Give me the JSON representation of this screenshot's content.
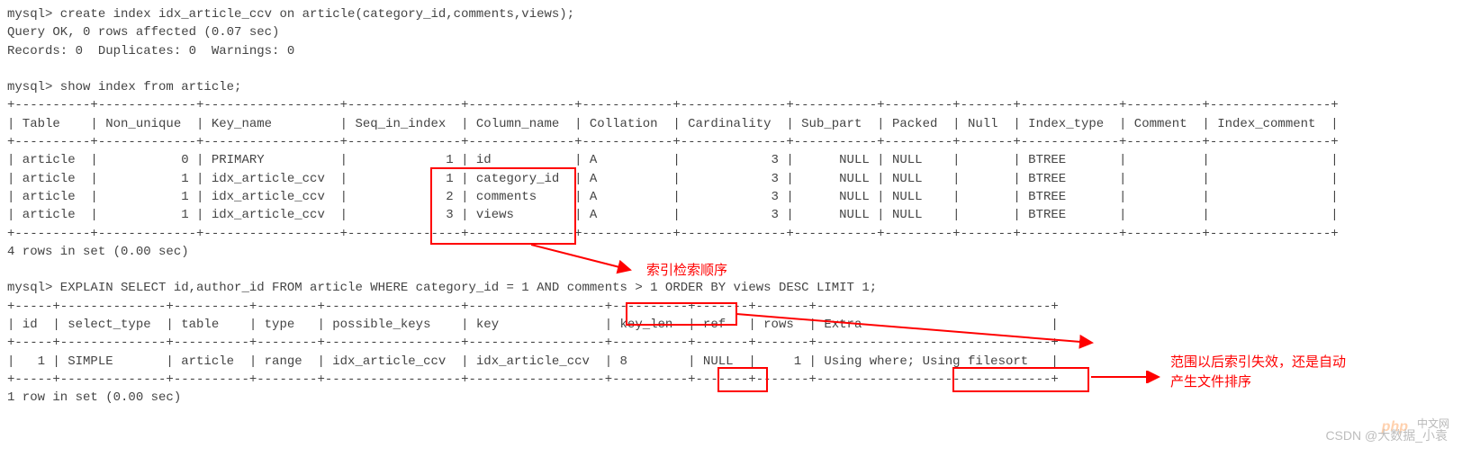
{
  "cmd": {
    "prompt": "mysql>",
    "create_index": "create index idx_article_ccv on article(category_id,comments,views);",
    "query_ok": "Query OK, 0 rows affected (0.07 sec)",
    "records": "Records: 0  Duplicates: 0  Warnings: 0",
    "show_index": "show index from article;",
    "rows_in_set_4": "4 rows in set (0.00 sec)",
    "explain_pre": "EXPLAIN SELECT id,author_id FROM article WHERE category_id = 1 AND ",
    "explain_boxed": "comments > 1",
    "explain_post": " ORDER BY views DESC LIMIT 1;",
    "row_in_set_1": "1 row in set (0.00 sec)"
  },
  "index_table": {
    "headers": [
      "Table",
      "Non_unique",
      "Key_name",
      "Seq_in_index",
      "Column_name",
      "Collation",
      "Cardinality",
      "Sub_part",
      "Packed",
      "Null",
      "Index_type",
      "Comment",
      "Index_comment"
    ],
    "rows": [
      {
        "Table": "article",
        "Non_unique": "0",
        "Key_name": "PRIMARY",
        "Seq_in_index": "1",
        "Column_name": "id",
        "Collation": "A",
        "Cardinality": "3",
        "Sub_part": "NULL",
        "Packed": "NULL",
        "Null": "",
        "Index_type": "BTREE",
        "Comment": "",
        "Index_comment": ""
      },
      {
        "Table": "article",
        "Non_unique": "1",
        "Key_name": "idx_article_ccv",
        "Seq_in_index": "1",
        "Column_name": "category_id",
        "Collation": "A",
        "Cardinality": "3",
        "Sub_part": "NULL",
        "Packed": "NULL",
        "Null": "",
        "Index_type": "BTREE",
        "Comment": "",
        "Index_comment": ""
      },
      {
        "Table": "article",
        "Non_unique": "1",
        "Key_name": "idx_article_ccv",
        "Seq_in_index": "2",
        "Column_name": "comments",
        "Collation": "A",
        "Cardinality": "3",
        "Sub_part": "NULL",
        "Packed": "NULL",
        "Null": "",
        "Index_type": "BTREE",
        "Comment": "",
        "Index_comment": ""
      },
      {
        "Table": "article",
        "Non_unique": "1",
        "Key_name": "idx_article_ccv",
        "Seq_in_index": "3",
        "Column_name": "views",
        "Collation": "A",
        "Cardinality": "3",
        "Sub_part": "NULL",
        "Packed": "NULL",
        "Null": "",
        "Index_type": "BTREE",
        "Comment": "",
        "Index_comment": ""
      }
    ]
  },
  "explain_table": {
    "headers": [
      "id",
      "select_type",
      "table",
      "type",
      "possible_keys",
      "key",
      "key_len",
      "ref",
      "rows",
      "Extra"
    ],
    "row": {
      "id": "1",
      "select_type": "SIMPLE",
      "table": "article",
      "type": "range",
      "possible_keys": "idx_article_ccv",
      "key": "idx_article_ccv",
      "key_len": "8",
      "ref": "NULL",
      "rows": "1",
      "extra_a": "Using where; ",
      "extra_b": "Using filesort"
    }
  },
  "annotations": {
    "a1": "索引检索顺序",
    "a2_line1": "范围以后索引失效，还是自动",
    "a2_line2": "产生文件排序"
  },
  "watermark": {
    "csdn": "CSDN @大数据_小袁",
    "php": "php",
    "cn": "中文网"
  },
  "chart_data": {
    "type": "table",
    "note": "two mysql result-set tables embedded as ASCII — see index_table and explain_table keys for structured data"
  }
}
